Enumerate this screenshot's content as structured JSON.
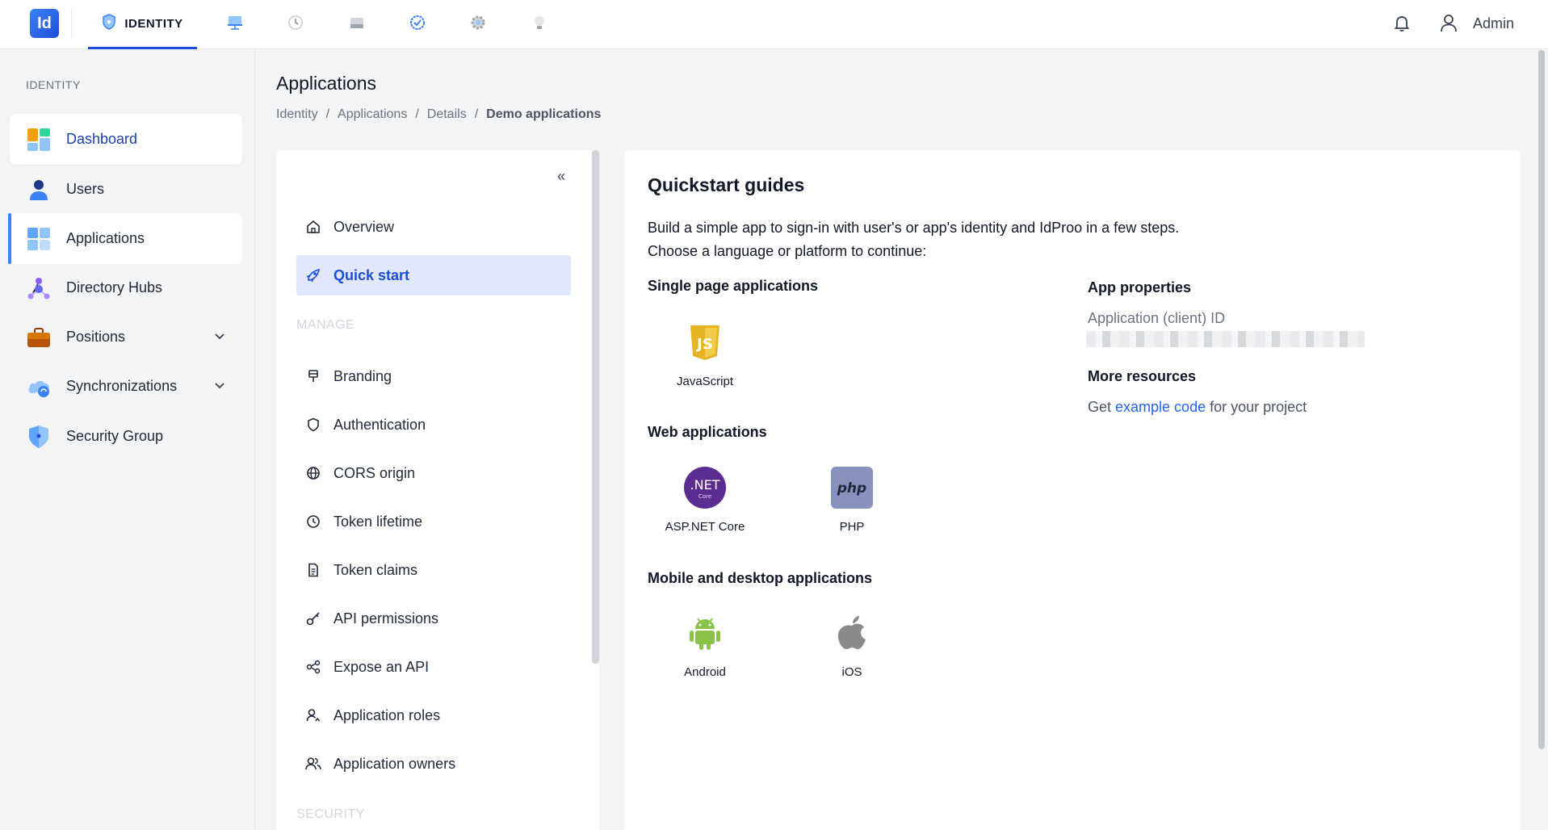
{
  "topbar": {
    "logo": "Id",
    "active_tab": "IDENTITY",
    "user_label": "Admin",
    "tab_icons": [
      "monitor-icon",
      "history-icon",
      "storage-icon",
      "check-circle-icon",
      "settings-icon",
      "bulb-icon"
    ]
  },
  "sidebar": {
    "heading": "IDENTITY",
    "items": [
      {
        "label": "Dashboard",
        "icon": "dashboard-icon"
      },
      {
        "label": "Users",
        "icon": "user-icon"
      },
      {
        "label": "Applications",
        "icon": "applications-icon"
      },
      {
        "label": "Directory Hubs",
        "icon": "hub-icon"
      },
      {
        "label": "Positions",
        "icon": "briefcase-icon"
      },
      {
        "label": "Synchronizations",
        "icon": "cloud-sync-icon"
      },
      {
        "label": "Security Group",
        "icon": "shield-icon"
      }
    ]
  },
  "header": {
    "title": "Applications",
    "breadcrumb": [
      "Identity",
      "Applications",
      "Details",
      "Demo applications"
    ],
    "separator": "/"
  },
  "menu": {
    "collapse": "«",
    "items_top": [
      {
        "label": "Overview"
      },
      {
        "label": "Quick start"
      }
    ],
    "manage_heading": "MANAGE",
    "manage_items": [
      {
        "label": "Branding"
      },
      {
        "label": "Authentication"
      },
      {
        "label": "CORS origin"
      },
      {
        "label": "Token lifetime"
      },
      {
        "label": "Token claims"
      },
      {
        "label": "API permissions"
      },
      {
        "label": "Expose an API"
      },
      {
        "label": "Application roles"
      },
      {
        "label": "Application owners"
      }
    ],
    "security_heading": "SECURITY"
  },
  "content": {
    "title": "Quickstart guides",
    "desc_line1": "Build a simple app to sign-in with user's or app's identity and IdProo in a few steps.",
    "desc_line2": "Choose a language or platform to continue:",
    "spa_heading": "Single page applications",
    "spa": [
      {
        "label": "JavaScript",
        "badge": "JS"
      }
    ],
    "web_heading": "Web applications",
    "web": [
      {
        "label": "ASP.NET Core",
        "badge": ".NET",
        "sub": "Core"
      },
      {
        "label": "PHP",
        "badge": "php"
      }
    ],
    "mobile_heading": "Mobile and desktop applications",
    "mobile": [
      {
        "label": "Android"
      },
      {
        "label": "iOS"
      }
    ],
    "props_heading": "App properties",
    "client_id_label": "Application (client) ID",
    "more_heading": "More resources",
    "more_prefix": "Get ",
    "more_link": "example code",
    "more_suffix": " for your project"
  }
}
